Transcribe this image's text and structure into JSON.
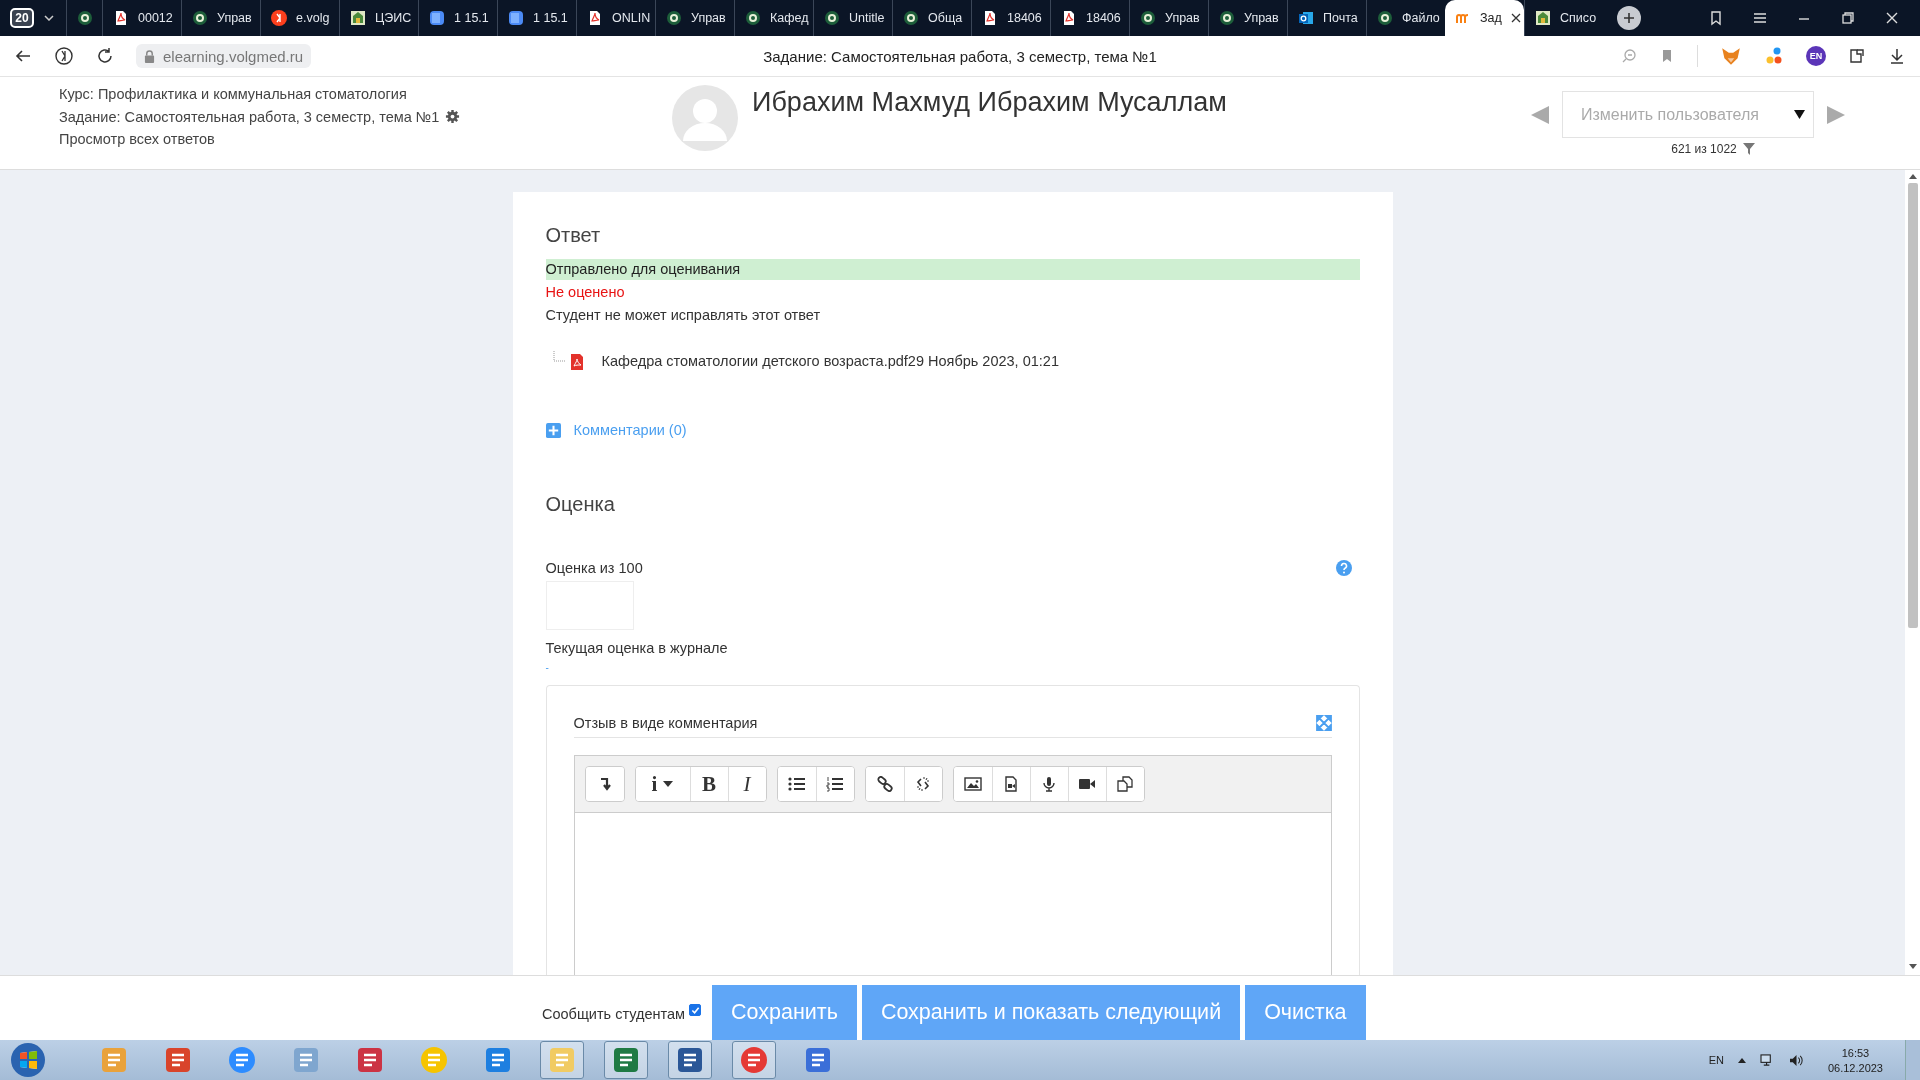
{
  "browser": {
    "tab_count": "20",
    "tabs": [
      {
        "kind": "seal",
        "selected": false
      },
      {
        "label": "00012",
        "kind": "pdf",
        "selected": false
      },
      {
        "label": "Управ",
        "kind": "seal",
        "selected": false
      },
      {
        "label": "e.volg",
        "kind": "ya",
        "selected": false
      },
      {
        "label": "ЦЭИС",
        "kind": "emblem",
        "selected": false
      },
      {
        "label": "1 15.1",
        "kind": "cube",
        "selected": false
      },
      {
        "label": "1 15.1",
        "kind": "cube",
        "selected": false
      },
      {
        "label": "ONLIN",
        "kind": "pdf",
        "selected": false
      },
      {
        "label": "Управ",
        "kind": "seal",
        "selected": false
      },
      {
        "label": "Кафед",
        "kind": "seal",
        "selected": false
      },
      {
        "label": "Untitle",
        "kind": "seal",
        "selected": false
      },
      {
        "label": "Обща",
        "kind": "seal",
        "selected": false
      },
      {
        "label": "18406",
        "kind": "pdf",
        "selected": false
      },
      {
        "label": "18406",
        "kind": "pdf",
        "selected": false
      },
      {
        "label": "Управ",
        "kind": "seal",
        "selected": false
      },
      {
        "label": "Управ",
        "kind": "seal",
        "selected": false
      },
      {
        "label": "Почта",
        "kind": "mail",
        "selected": false
      },
      {
        "label": "Файло",
        "kind": "seal",
        "selected": false
      },
      {
        "label": "Зад",
        "kind": "moodle",
        "selected": true
      },
      {
        "label": "Списо",
        "kind": "emblem",
        "selected": false
      }
    ],
    "url": "elearning.volgmed.ru",
    "page_title": "Задание: Самостоятельная работа, 3 семестр, тема №1",
    "profile": "EN"
  },
  "header": {
    "course": "Курс: Профилактика и коммунальная стоматология",
    "assignment": "Задание: Самостоятельная работа, 3 семестр, тема №1",
    "view_all": "Просмотр всех ответов",
    "student_name": "Ибрахим Махмуд Ибрахим Мусаллам",
    "user_select": {
      "placeholder": "Изменить пользователя"
    },
    "counter": "621 из 1022"
  },
  "submission": {
    "heading": "Ответ",
    "status": "Отправлено для оценивания",
    "grading_status": "Не оценено",
    "edit_status": "Студент не может исправлять этот ответ",
    "file": {
      "name": "Кафедра стоматологии детского возраста.pdf",
      "date": "29 Ноябрь 2023, 01:21"
    },
    "comments": "Комментарии (0)"
  },
  "grade": {
    "heading": "Оценка",
    "label": "Оценка из 100",
    "current_label": "Текущая оценка в журнале",
    "current_value": "-",
    "feedback_label": "Отзыв в виде комментария",
    "toolbar": [
      [
        {
          "kind": "paragraph"
        }
      ],
      [
        {
          "kind": "info",
          "label": "i"
        },
        {
          "kind": "bold",
          "label": "B"
        },
        {
          "kind": "italic",
          "label": "I"
        }
      ],
      [
        {
          "kind": "ul"
        },
        {
          "kind": "ol"
        }
      ],
      [
        {
          "kind": "link"
        },
        {
          "kind": "unlink"
        }
      ],
      [
        {
          "kind": "image"
        },
        {
          "kind": "media"
        },
        {
          "kind": "audio"
        },
        {
          "kind": "video"
        },
        {
          "kind": "copy"
        }
      ]
    ]
  },
  "footer": {
    "notify_label": "Сообщить студентам",
    "notify_checked": true,
    "buttons": [
      "Сохранить",
      "Сохранить и показать следующий",
      "Очистка"
    ]
  },
  "taskbar": {
    "apps": [
      {
        "kind": "paint",
        "running": false
      },
      {
        "kind": "slides",
        "running": false
      },
      {
        "kind": "zoom",
        "running": false
      },
      {
        "kind": "calc",
        "running": false
      },
      {
        "kind": "snip",
        "running": false
      },
      {
        "kind": "onec",
        "running": false
      },
      {
        "kind": "chart",
        "running": false
      },
      {
        "kind": "folder",
        "running": true
      },
      {
        "kind": "excel",
        "running": true
      },
      {
        "kind": "word",
        "running": true
      },
      {
        "kind": "yandex",
        "running": true
      },
      {
        "kind": "hourglass",
        "running": false
      }
    ],
    "language": "EN",
    "time": "16:53",
    "date": "06.12.2023"
  }
}
